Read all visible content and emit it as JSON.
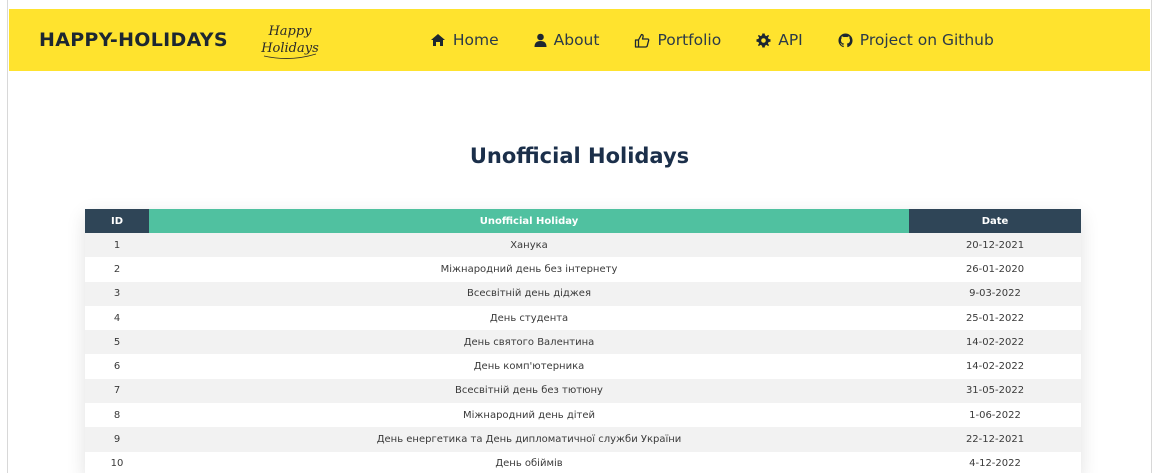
{
  "header": {
    "brand": "HAPPY-HOLIDAYS",
    "logo_text": "Happy Holidays",
    "nav": [
      {
        "label": "Home",
        "icon": "home-icon"
      },
      {
        "label": "About",
        "icon": "user-icon"
      },
      {
        "label": "Portfolio",
        "icon": "thumbs-up-icon"
      },
      {
        "label": "API",
        "icon": "gear-icon"
      },
      {
        "label": "Project on Github",
        "icon": "github-icon"
      }
    ],
    "bg_color": "#ffe32e"
  },
  "main": {
    "title": "Unofficial Holidays",
    "table": {
      "columns": [
        "ID",
        "Unofficial Holiday",
        "Date"
      ],
      "rows": [
        {
          "id": "1",
          "holiday": "Ханука",
          "date": "20-12-2021"
        },
        {
          "id": "2",
          "holiday": "Міжнародний день без інтернету",
          "date": "26-01-2020"
        },
        {
          "id": "3",
          "holiday": "Всесвітній день діджея",
          "date": "9-03-2022"
        },
        {
          "id": "4",
          "holiday": "День студента",
          "date": "25-01-2022"
        },
        {
          "id": "5",
          "holiday": "День святого Валентина",
          "date": "14-02-2022"
        },
        {
          "id": "6",
          "holiday": "День комп'ютерника",
          "date": "14-02-2022"
        },
        {
          "id": "7",
          "holiday": "Всесвітній день без тютюну",
          "date": "31-05-2022"
        },
        {
          "id": "8",
          "holiday": "Міжнародний день дітей",
          "date": "1-06-2022"
        },
        {
          "id": "9",
          "holiday": "День енергетика та День дипломатичної служби України",
          "date": "22-12-2021"
        },
        {
          "id": "10",
          "holiday": "День обіймів",
          "date": "4-12-2022"
        }
      ],
      "header_colors": {
        "id": "#2f4557",
        "holiday": "#50c1a0",
        "date": "#2f4557"
      }
    }
  }
}
